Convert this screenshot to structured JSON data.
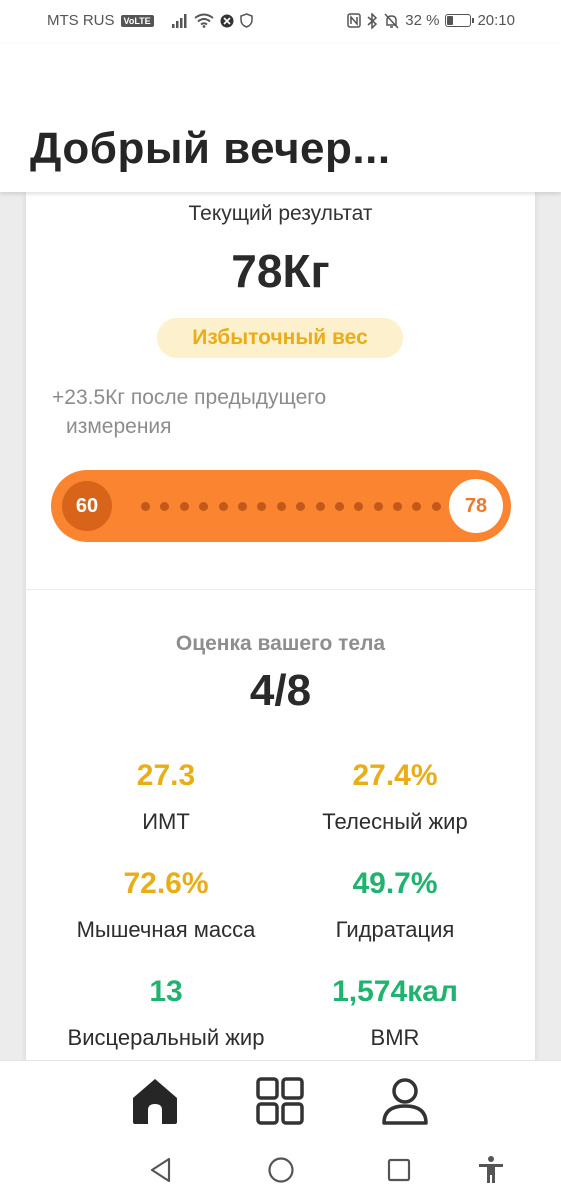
{
  "status_bar": {
    "carrier": "MTS RUS",
    "volte": "VoLTE",
    "battery_percent": "32 %",
    "battery_level": 0.32,
    "time": "20:10",
    "icons": [
      "signal-icon",
      "wifi-icon",
      "vpn-icon",
      "shield-icon",
      "nfc-icon",
      "bluetooth-icon",
      "bell-off-icon",
      "battery-icon"
    ]
  },
  "header": {
    "greeting": "Добрый вечер..."
  },
  "result": {
    "label": "Текущий результат",
    "weight": "78Кг",
    "status_badge": "Избыточный вес",
    "status_color": "#e9ad18",
    "change_line1": "+23.5Кг после предыдущего",
    "change_line2": "измерения",
    "slider": {
      "start_value": "60",
      "end_value": "78",
      "color": "#fb8431"
    }
  },
  "body_score": {
    "label": "Оценка вашего тела",
    "value": "4/8"
  },
  "metrics": [
    {
      "value": "27.3",
      "label": "ИМТ",
      "color": "#e9ad18"
    },
    {
      "value": "27.4%",
      "label": "Телесный жир",
      "color": "#e9ad18"
    },
    {
      "value": "72.6%",
      "label": "Мышечная масса",
      "color": "#e9ad18"
    },
    {
      "value": "49.7%",
      "label": "Гидратация",
      "color": "#20b36f"
    },
    {
      "value": "13",
      "label": "Висцеральный жир",
      "color": "#20b36f"
    },
    {
      "value": "1,574кал",
      "label": "BMR",
      "color": "#20b36f"
    }
  ],
  "bottom_nav": {
    "items": [
      "home-icon",
      "grid-icon",
      "profile-icon"
    ],
    "active": "home-icon"
  },
  "system_nav": {
    "items": [
      "back-icon",
      "home-circle-icon",
      "recent-apps-icon",
      "accessibility-icon"
    ]
  }
}
